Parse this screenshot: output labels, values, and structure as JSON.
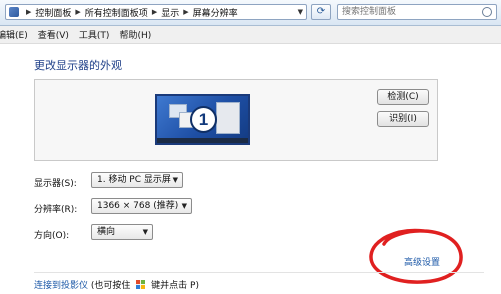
{
  "address_bar": {
    "crumbs": [
      "控制面板",
      "所有控制面板项",
      "显示",
      "屏幕分辨率"
    ],
    "search_placeholder": "搜索控制面板"
  },
  "menu": [
    "编辑(E)",
    "查看(V)",
    "工具(T)",
    "帮助(H)"
  ],
  "page": {
    "title": "更改显示器的外观",
    "monitor_number": "1",
    "detect_button": "检测(C)",
    "identify_button": "识别(I)"
  },
  "form": {
    "display_label": "显示器(S):",
    "display_value": "1. 移动 PC 显示屏",
    "resolution_label": "分辨率(R):",
    "resolution_value": "1366 × 768 (推荐)",
    "orientation_label": "方向(O):",
    "orientation_value": "横向"
  },
  "advanced_link": "高级设置",
  "bottom": {
    "projector_link": "连接到投影仪",
    "hint_before": "(也可按住",
    "hint_after": "键并点击 P)"
  },
  "colors": {
    "link": "#1e5aa8",
    "title": "#1e3f88",
    "annotation": "#e02020"
  }
}
